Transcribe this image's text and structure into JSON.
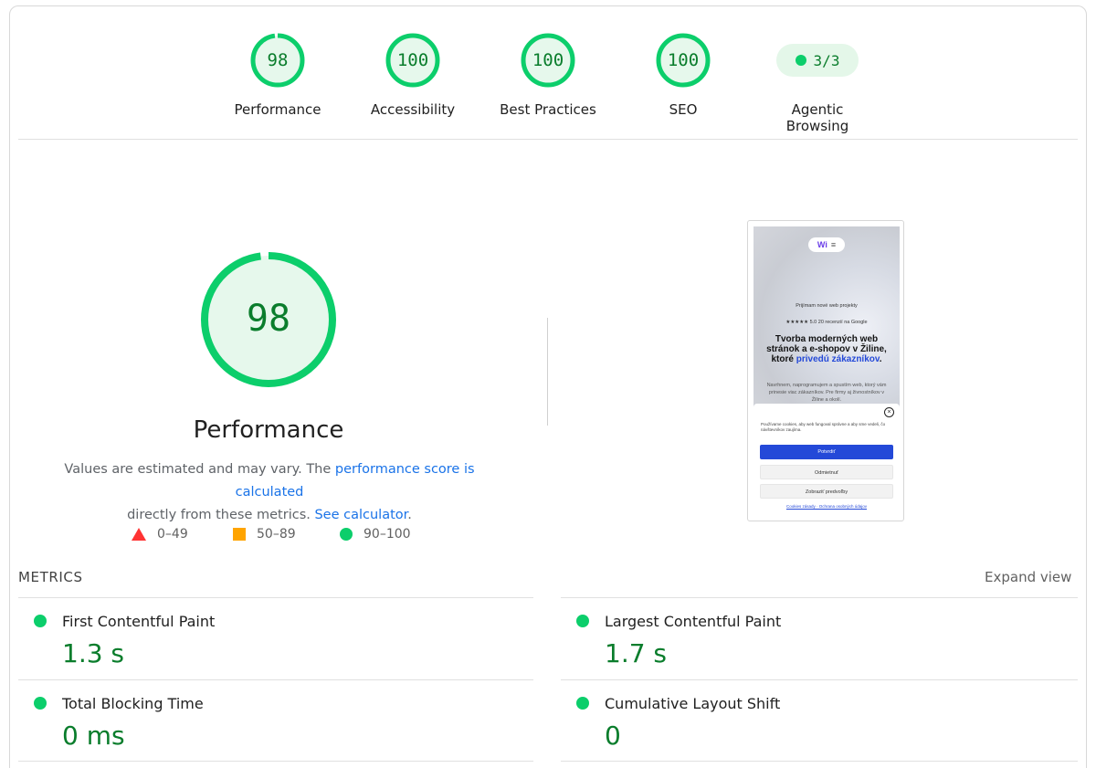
{
  "colors": {
    "pass": "#0cce6b",
    "pass_text": "#0a7d2c",
    "fail": "#ff3333",
    "average": "#ffa400",
    "link": "#1a73e8"
  },
  "categories": [
    {
      "score": "98",
      "label": "Performance",
      "fraction": 0.98
    },
    {
      "score": "100",
      "label": "Accessibility",
      "fraction": 1.0
    },
    {
      "score": "100",
      "label": "Best Practices",
      "fraction": 1.0
    },
    {
      "score": "100",
      "label": "SEO",
      "fraction": 1.0
    }
  ],
  "agentic": {
    "score": "3/3",
    "label": "Agentic Browsing"
  },
  "performance": {
    "score": "98",
    "fraction": 0.98,
    "title": "Performance",
    "desc_prefix": "Values are estimated and may vary. The ",
    "desc_link": "performance score is calculated",
    "desc_mid": " directly from these metrics. ",
    "desc_link2": "See calculator",
    "desc_suffix": "."
  },
  "legend": {
    "fail": "0–49",
    "average": "50–89",
    "pass": "90–100"
  },
  "thumbnail": {
    "logo": "Wi",
    "menu": "≡",
    "badge": "Prijímam nové web projekty",
    "rating": "★★★★★ 5.0  20 recenzií na Google",
    "headline_1": "Tvorba moderných web stránok a e-shopov v Žiline, ktoré ",
    "headline_blue": "privedú zákazníkov",
    "headline_2": ".",
    "sub": "Navrhnem, naprogramujem a spustím web, ktorý vám prinesie viac zákazníkov. Pre firmy aj živnostníkov v Žiline a okolí.",
    "close": "×",
    "cookie_text": "Používame cookies, aby web fungoval správne a aby sme vedeli, čo návštevníkov zaujíma.",
    "btn_confirm": "Potvrdiť",
    "btn_reject": "Odmietnuť",
    "btn_prefs": "Zobraziť predvoľby",
    "links": "Cookies zásady · Ochrana osobných údajov"
  },
  "metrics_section": {
    "title": "METRICS",
    "expand": "Expand view"
  },
  "metrics": [
    {
      "name": "First Contentful Paint",
      "value": "1.3 s"
    },
    {
      "name": "Largest Contentful Paint",
      "value": "1.7 s"
    },
    {
      "name": "Total Blocking Time",
      "value": "0 ms"
    },
    {
      "name": "Cumulative Layout Shift",
      "value": "0"
    }
  ]
}
